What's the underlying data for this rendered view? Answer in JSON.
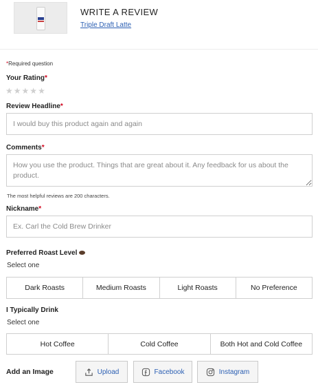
{
  "header": {
    "title": "WRITE A REVIEW",
    "product_link": "Triple Draft Latte"
  },
  "form": {
    "required_note_star": "*",
    "required_note": "Required question",
    "rating": {
      "label": "Your Rating",
      "required_mark": "*",
      "max_stars": 5,
      "selected": 0
    },
    "headline": {
      "label": "Review Headline",
      "required_mark": "*",
      "placeholder": "I would buy this product again and again"
    },
    "comments": {
      "label": "Comments",
      "required_mark": "*",
      "placeholder": "How you use the product. Things that are great about it. Any feedback for us about the product."
    },
    "hint": "The most helpful reviews are 200 characters.",
    "nickname": {
      "label": "Nickname",
      "required_mark": "*",
      "placeholder": "Ex. Carl the Cold Brew Drinker"
    },
    "roast": {
      "label": "Preferred Roast Level",
      "icon": "coffee-bean-icon",
      "sublabel": "Select one",
      "options": [
        "Dark Roasts",
        "Medium Roasts",
        "Light Roasts",
        "No Preference"
      ]
    },
    "drink": {
      "label": "I Typically Drink",
      "sublabel": "Select one",
      "options": [
        "Hot Coffee",
        "Cold Coffee",
        "Both Hot and Cold Coffee"
      ]
    },
    "image": {
      "label": "Add an Image",
      "buttons": [
        {
          "label": "Upload",
          "icon": "upload-icon"
        },
        {
          "label": "Facebook",
          "icon": "facebook-icon"
        },
        {
          "label": "Instagram",
          "icon": "instagram-icon"
        }
      ]
    }
  },
  "colors": {
    "required_star": "#d0021b",
    "link": "#2b5fb3",
    "border": "#cfcfcf",
    "star_empty": "#cfcfcf"
  }
}
